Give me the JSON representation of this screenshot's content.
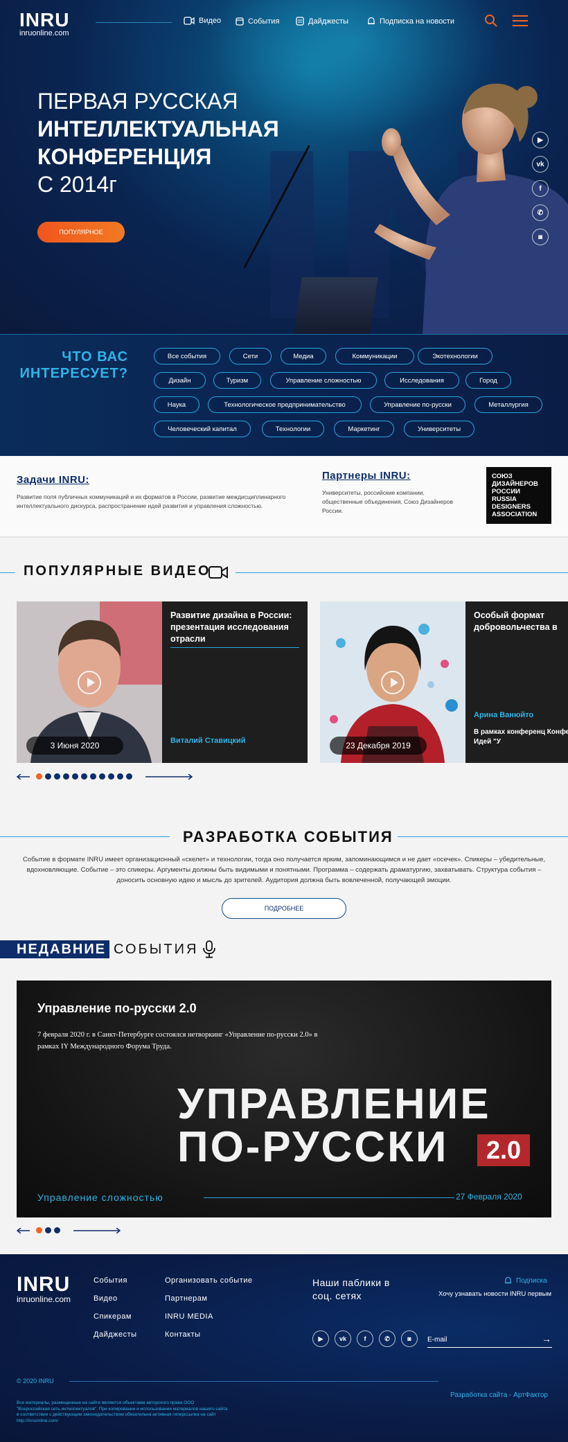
{
  "header": {
    "logo": "INRU",
    "logo_sub": "inruonline.com",
    "nav": [
      {
        "label": "Видео",
        "icon": "video-icon"
      },
      {
        "label": "События",
        "icon": "calendar-icon"
      },
      {
        "label": "Дайджесты",
        "icon": "digest-icon"
      },
      {
        "label": "Подписка на новости",
        "icon": "bell-icon"
      }
    ]
  },
  "hero": {
    "title_line1": "ПЕРВАЯ РУССКАЯ",
    "title_line2": "ИНТЕЛЛЕКТУАЛЬНАЯ",
    "title_line3": "КОНФЕРЕНЦИЯ",
    "title_line4": "С 2014г",
    "button": "ПОПУЛЯРНОЕ",
    "social": [
      "youtube-icon",
      "vk-icon",
      "facebook-icon",
      "viber-icon",
      "instagram-icon"
    ],
    "accent_color": "#f06521"
  },
  "interest": {
    "title_line1": "ЧТО ВАС",
    "title_line2": "ИНТЕРЕСУЕТ?",
    "chips": [
      "Все события",
      "Сети",
      "Медиа",
      "Коммуникации",
      "Экотехнологии",
      "Дизайн",
      "Туризм",
      "Управление сложностью",
      "Исследования",
      "Город",
      "Наука",
      "Технологическое предпринимательство",
      "Управление по-русски",
      "Металлургия",
      "Человеческий капитал",
      "Технологии",
      "Маркетинг",
      "Университеты"
    ]
  },
  "tasks": {
    "title": "Задачи INRU:",
    "text": "Развитие поля публичных коммуникаций и их форматов в России, развитие междисциплинарного интеллектуального дискурса, распространение идей развития и управления сложностью.",
    "partners_title": "Партнеры INRU:",
    "partners_text": "Университеты, российские компании, общественные объединения, Союз Дизайнеров России.",
    "partner_logo": [
      "СОЮЗ",
      "ДИЗАЙНЕРОВ",
      "РОССИИ",
      "RUSSIA",
      "DESIGNERS",
      "ASSOCIATION"
    ]
  },
  "videos": {
    "section_title": "ПОПУЛЯРНЫЕ ВИДЕО",
    "items": [
      {
        "title": "Развитие дизайна в России: презентация исследования отрасли",
        "speaker": "Виталий Ставицкий",
        "event": "",
        "date": "3 Июня 2020"
      },
      {
        "title": "Особый формат добровольчества в",
        "speaker": "Арина Ванюйто",
        "event": "В рамках конференц Конференция Идей \"У",
        "date": "23 Декабря 2019"
      }
    ],
    "pager_count": 11,
    "pager_active": 0
  },
  "development": {
    "title": "РАЗРАБОТКА СОБЫТИЯ",
    "text": "Событие в формате INRU имеет организационный «скелет» и технологии, тогда оно получается ярким, запоминающимся и не дает «осечек». Спикеры – убедительные, вдохновляющие. Событие – это спикеры. Аргументы должны быть видимыми и понятными. Программа – содержать драматургию, захватывать. Структура события – доносить основную идею и мысль до зрителей. Аудитория должна быть вовлеченной, получающей эмоции.",
    "button": "ПОДРОБНЕЕ"
  },
  "recent": {
    "title_part1": "НЕДАВНИЕ",
    "title_part2": "СОБЫТИЯ",
    "event": {
      "title": "Управление по-русски 2.0",
      "description": "7 февраля 2020 г. в Санкт-Петербурге состоялся нетворкинг «Управление по-русски 2.0» в рамках IY Международного Форума Труда.",
      "big_line1": "УПРАВЛЕНИЕ",
      "big_line2": "ПО-РУССКИ",
      "version": "2.0",
      "category": "Управление сложностью",
      "date": "27 Февраля 2020"
    },
    "pager_count": 3,
    "pager_active": 0
  },
  "footer": {
    "logo": "INRU",
    "logo_sub": "inruonline.com",
    "links_col1": [
      "События",
      "Видео",
      "Спикерам",
      "Дайджесты"
    ],
    "links_col2": [
      "Организовать событие",
      "Партнерам",
      "INRU MEDIA",
      "Контакты"
    ],
    "social_title": "Наши паблики в соц. сетях",
    "subscribe": "Подписка",
    "subscribe_text": "Хочу узнавать новости INRU первым",
    "email_placeholder": "E-mail",
    "copyright": "© 2020 INRU",
    "developer": "Разработка сайта - АртФактор",
    "legal": "Все материалы, размещенные на сайте являются объектами авторского права ООО \"Всероссийская сеть интеллектуалов\". При копировании и использовании материалов нашего сайта в соответствии с действующим законодательством обязательна активная гиперссылка на сайт http://inruonline.com/"
  }
}
